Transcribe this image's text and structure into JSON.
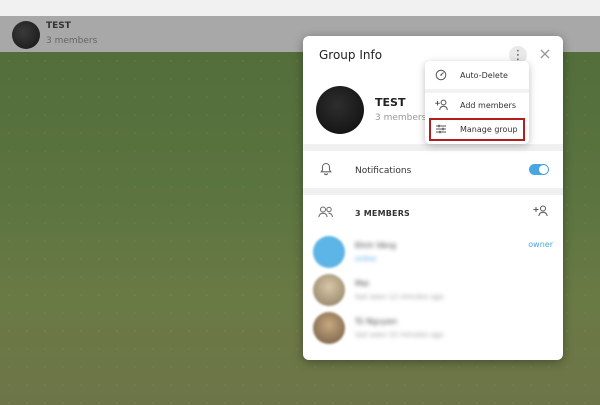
{
  "chat": {
    "title": "TEST",
    "subtitle": "3 members"
  },
  "group_info": {
    "title": "Group Info",
    "kebab_icon": "⋮",
    "close_icon": "×",
    "group_name": "TEST",
    "member_count": "3 members"
  },
  "menu": {
    "items": [
      {
        "label": "Auto-Delete",
        "icon": "timer-icon",
        "glyph": "◔"
      },
      {
        "label": "Add members",
        "icon": "add-member-icon",
        "glyph": "⁺⚇"
      },
      {
        "label": "Manage group",
        "icon": "sliders-icon",
        "glyph": "☰"
      }
    ],
    "highlighted": "Manage group"
  },
  "notifications": {
    "label": "Notifications",
    "icon": "bell-icon",
    "glyph": "🔔",
    "enabled": true
  },
  "members": {
    "header": "3 MEMBERS",
    "icon_glyph": "⚇",
    "add_glyph": "+⚇",
    "list": [
      {
        "name": "Đinh Vàng",
        "status": "online",
        "role": "owner",
        "avatar_color": "#5db4e6"
      },
      {
        "name": "Mai",
        "status": "last seen 12 minutes ago",
        "role": "",
        "avatar_color": "#b6a58a"
      },
      {
        "name": "Tú Nguyen",
        "status": "last seen 15 minutes ago",
        "role": "",
        "avatar_color": "#a08060"
      }
    ]
  },
  "colors": {
    "accent": "#48a6e2",
    "highlight_border": "#b71c1c"
  }
}
